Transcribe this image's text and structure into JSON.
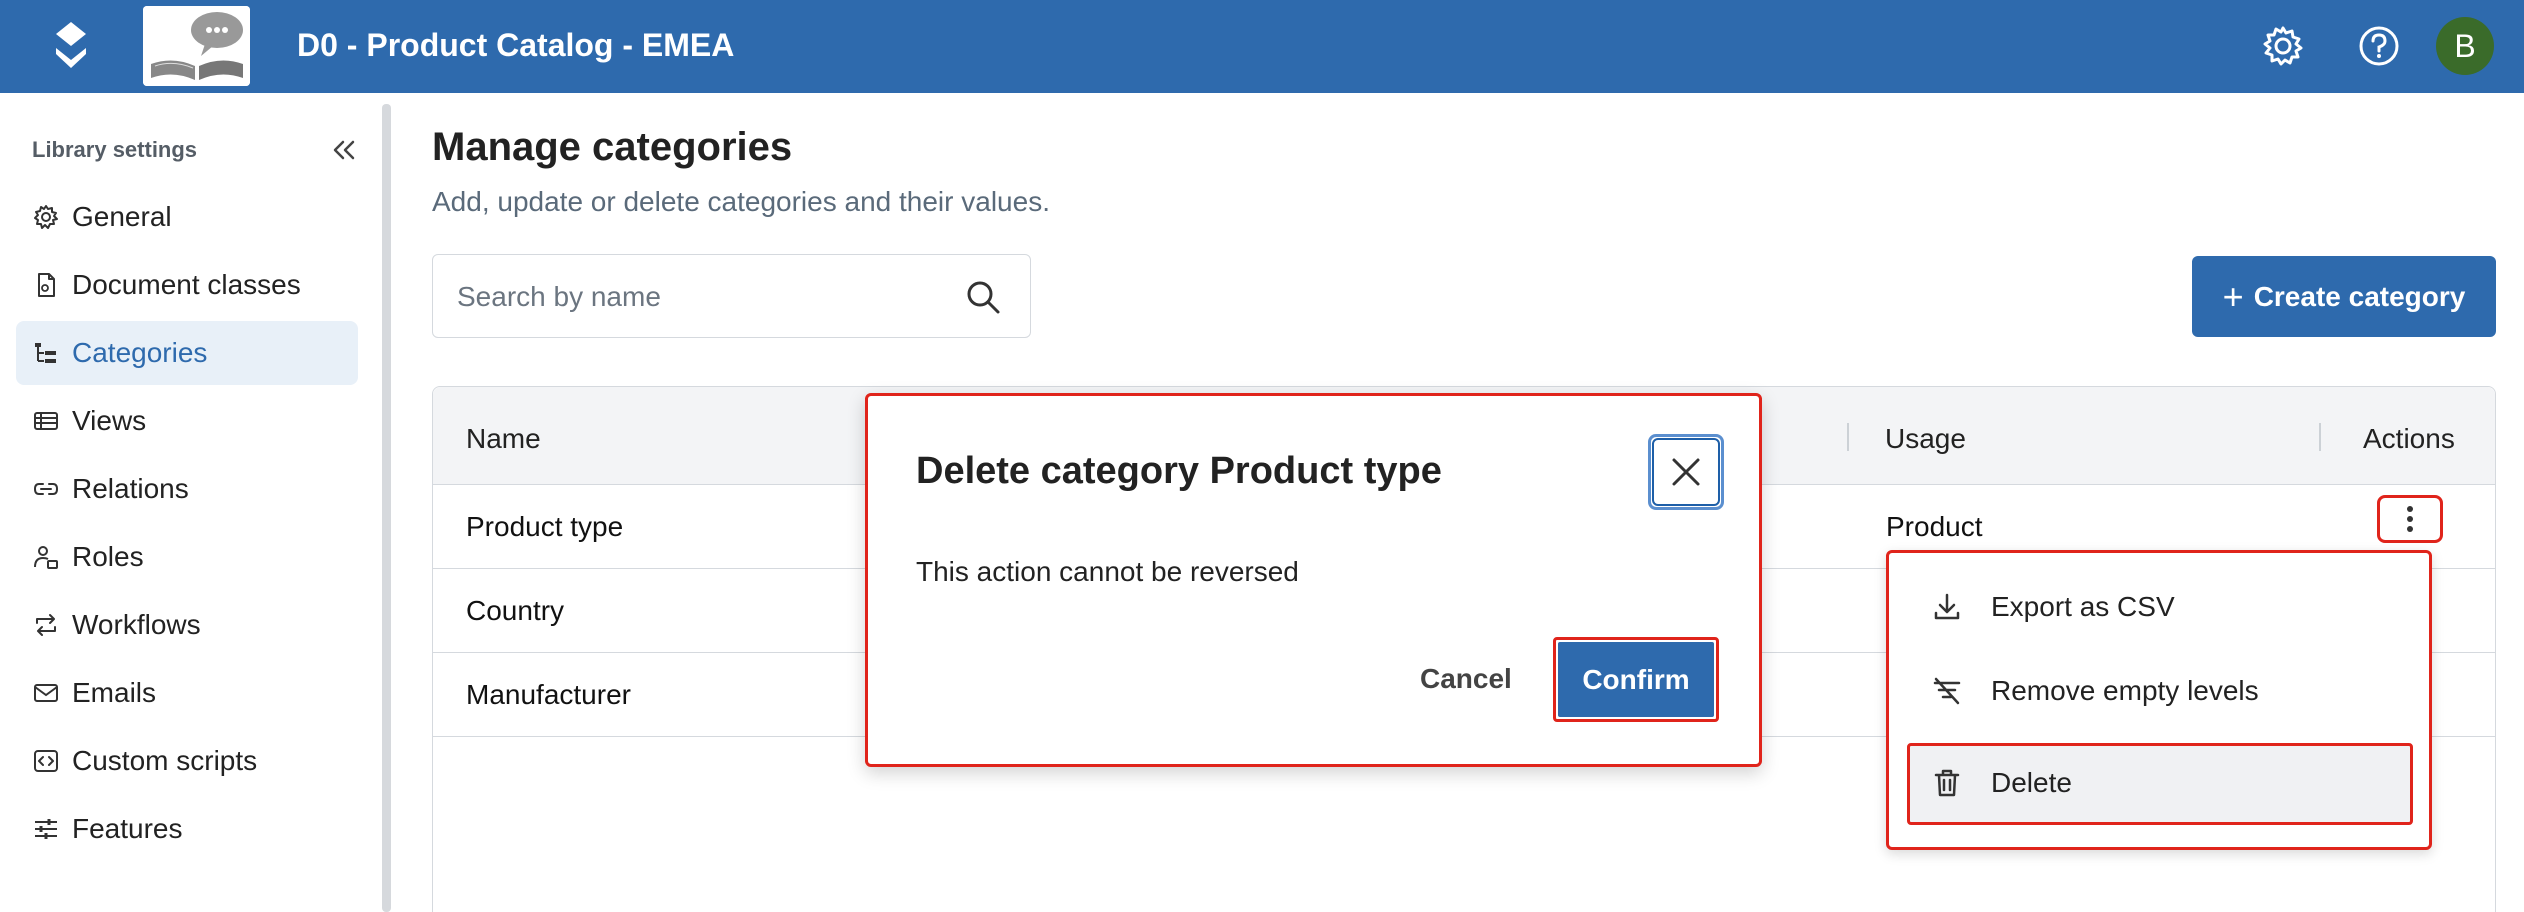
{
  "header": {
    "app_title": "D0 - Product Catalog - EMEA",
    "avatar_initial": "B",
    "brand_color": "#2e6aad",
    "avatar_color": "#3a6b2a"
  },
  "sidebar": {
    "title": "Library settings",
    "items": [
      {
        "label": "General",
        "icon": "gear-icon"
      },
      {
        "label": "Document classes",
        "icon": "document-icon"
      },
      {
        "label": "Categories",
        "icon": "tree-icon",
        "active": true
      },
      {
        "label": "Views",
        "icon": "table-icon"
      },
      {
        "label": "Relations",
        "icon": "link-icon"
      },
      {
        "label": "Roles",
        "icon": "user-key-icon"
      },
      {
        "label": "Workflows",
        "icon": "repeat-icon"
      },
      {
        "label": "Emails",
        "icon": "mail-icon"
      },
      {
        "label": "Custom scripts",
        "icon": "code-icon"
      },
      {
        "label": "Features",
        "icon": "sliders-icon"
      }
    ]
  },
  "main": {
    "title": "Manage categories",
    "subtitle": "Add, update or delete categories and their values.",
    "search": {
      "placeholder": "Search by name",
      "value": ""
    },
    "create_button": "Create category",
    "create_icon": "+"
  },
  "table": {
    "columns": [
      "Name",
      "Usage",
      "Actions"
    ],
    "rows": [
      {
        "name": "Product type",
        "usage": "Product"
      },
      {
        "name": "Country",
        "usage": ""
      },
      {
        "name": "Manufacturer",
        "usage": ""
      }
    ]
  },
  "menu": {
    "items": [
      {
        "label": "Export as CSV",
        "icon": "download-icon"
      },
      {
        "label": "Remove empty levels",
        "icon": "filter-off-icon"
      },
      {
        "label": "Delete",
        "icon": "trash-icon"
      }
    ]
  },
  "modal": {
    "title": "Delete category Product type",
    "body": "This action cannot be reversed",
    "cancel_label": "Cancel",
    "confirm_label": "Confirm",
    "highlight_color": "#e0241b"
  }
}
